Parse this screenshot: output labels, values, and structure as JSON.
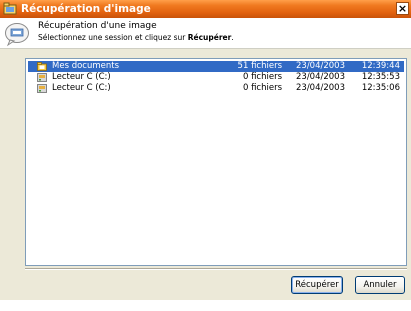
{
  "window": {
    "title": "Récupération d'image"
  },
  "header": {
    "title": "Récupération d'une image",
    "subtitle_prefix": "Sélectionnez une session et cliquez sur ",
    "subtitle_bold": "Récupérer",
    "subtitle_suffix": "."
  },
  "list": {
    "rows": [
      {
        "name": "Mes documents",
        "count": "51 fichiers",
        "date": "23/04/2003",
        "time": "12:39:44",
        "selected": true,
        "icon": "documents-folder-icon"
      },
      {
        "name": "Lecteur C (C:)",
        "count": "0 fichiers",
        "date": "23/04/2003",
        "time": "12:35:53",
        "selected": false,
        "icon": "drive-icon"
      },
      {
        "name": "Lecteur C (C:)",
        "count": "0 fichiers",
        "date": "23/04/2003",
        "time": "12:35:06",
        "selected": false,
        "icon": "drive-icon"
      }
    ]
  },
  "buttons": {
    "recover": "Récupérer",
    "cancel": "Annuler"
  },
  "colors": {
    "titlebar": "#e2620f",
    "selection": "#316ac5"
  }
}
